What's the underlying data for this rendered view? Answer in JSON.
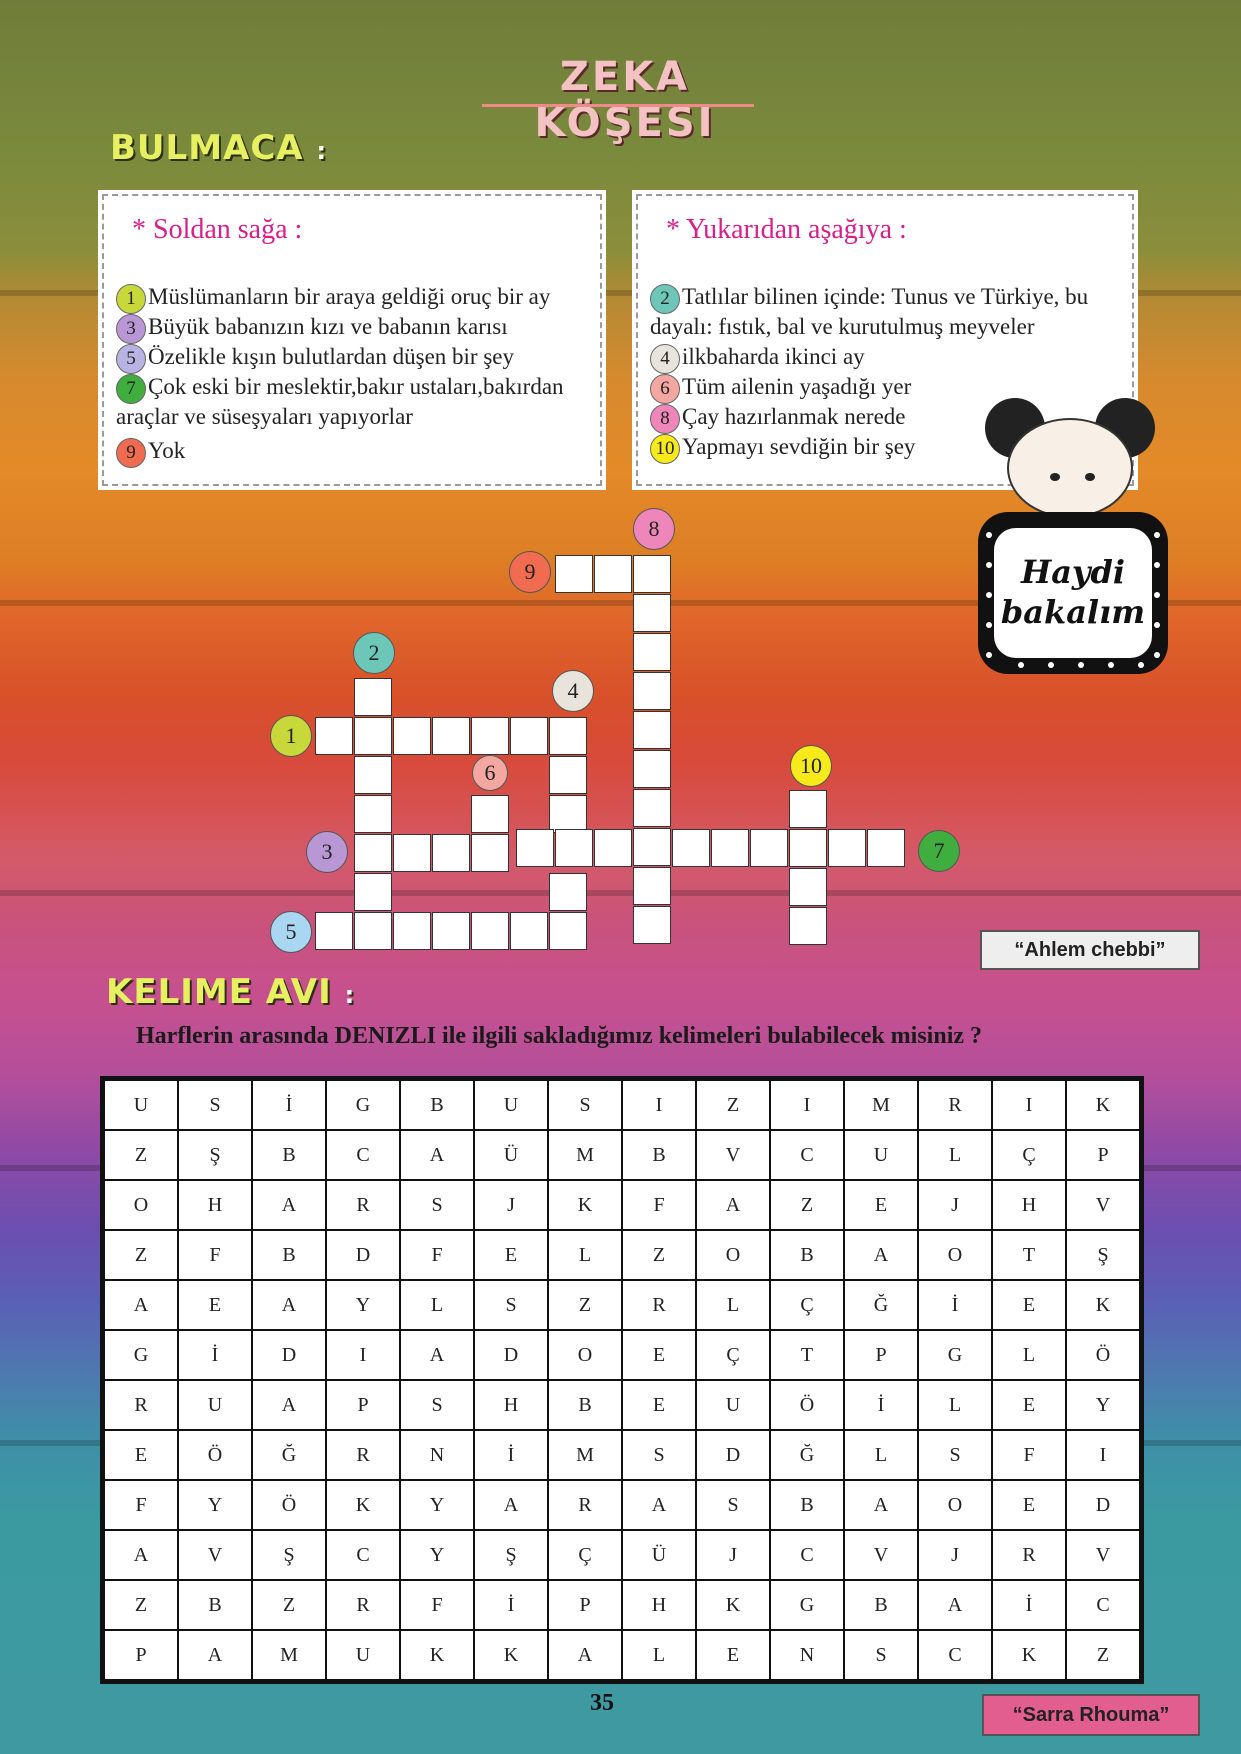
{
  "title": "ZEKA KÖŞESI",
  "bulmaca": {
    "heading": "BULMACA",
    "colon": ":",
    "across": {
      "heading": "* Soldan sağa :",
      "clues": [
        {
          "num": "1",
          "color": "#c8d83a",
          "text": "Müslümanların bir araya geldiği oruç bir ay"
        },
        {
          "num": "3",
          "color": "#b897d4",
          "text": "Büyük babanızın kızı ve babanın karısı"
        },
        {
          "num": "5",
          "color": "#b9b3e3",
          "text": "Özelikle kışın bulutlardan düşen bir şey"
        },
        {
          "num": "7",
          "color": "#3fae3f",
          "text": "Çok eski bir meslektir,bakır ustaları,bakırdan",
          "text2": "araçlar ve süseşyaları yapıyorlar"
        },
        {
          "num": "9",
          "color": "#f06b4f",
          "text": "Yok"
        }
      ]
    },
    "down": {
      "heading": "* Yukarıdan aşağıya :",
      "clues": [
        {
          "num": "2",
          "color": "#6cc7b9",
          "text": "Tatlılar bilinen içinde: Tunus ve Türkiye, bu",
          "text2": "dayalı: fıstık, bal ve kurutulmuş meyveler"
        },
        {
          "num": "4",
          "color": "#e8e4dc",
          "text": "ilkbaharda ikinci ay"
        },
        {
          "num": "6",
          "color": "#f4a7a1",
          "text": "Tüm ailenin yaşadığı yer"
        },
        {
          "num": "8",
          "color": "#ee86b9",
          "text": "Çay hazırlanmak nerede"
        },
        {
          "num": "10",
          "color": "#f6ea1a",
          "text": "Yapmayı sevdiğin bir şey"
        }
      ]
    },
    "numbers": [
      "1",
      "2",
      "3",
      "4",
      "5",
      "6",
      "7",
      "8",
      "9",
      "10"
    ]
  },
  "haydi": "Haydi bakalım",
  "credit1": "“Ahlem chebbi”",
  "kelime_avi": {
    "heading": "KELIME AVI",
    "colon": ":",
    "question": "Harflerin arasında DENIZLI ile ilgili sakladığımız kelimeleri bulabilecek misiniz ?",
    "rows": [
      [
        "U",
        "S",
        "İ",
        "G",
        "B",
        "U",
        "S",
        "I",
        "Z",
        "I",
        "M",
        "R",
        "I",
        "K"
      ],
      [
        "Z",
        "Ş",
        "B",
        "C",
        "A",
        "Ü",
        "M",
        "B",
        "V",
        "C",
        "U",
        "L",
        "Ç",
        "P"
      ],
      [
        "O",
        "H",
        "A",
        "R",
        "S",
        "J",
        "K",
        "F",
        "A",
        "Z",
        "E",
        "J",
        "H",
        "V"
      ],
      [
        "Z",
        "F",
        "B",
        "D",
        "F",
        "E",
        "L",
        "Z",
        "O",
        "B",
        "A",
        "O",
        "T",
        "Ş"
      ],
      [
        "A",
        "E",
        "A",
        "Y",
        "L",
        "S",
        "Z",
        "R",
        "L",
        "Ç",
        "Ğ",
        "İ",
        "E",
        "K"
      ],
      [
        "G",
        "İ",
        "D",
        "I",
        "A",
        "D",
        "O",
        "E",
        "Ç",
        "T",
        "P",
        "G",
        "L",
        "Ö"
      ],
      [
        "R",
        "U",
        "A",
        "P",
        "S",
        "H",
        "B",
        "E",
        "U",
        "Ö",
        "İ",
        "L",
        "E",
        "Y"
      ],
      [
        "E",
        "Ö",
        "Ğ",
        "R",
        "N",
        "İ",
        "M",
        "S",
        "D",
        "Ğ",
        "L",
        "S",
        "F",
        "I"
      ],
      [
        "F",
        "Y",
        "Ö",
        "K",
        "Y",
        "A",
        "R",
        "A",
        "S",
        "B",
        "A",
        "O",
        "E",
        "D"
      ],
      [
        "A",
        "V",
        "Ş",
        "C",
        "Y",
        "Ş",
        "Ç",
        "Ü",
        "J",
        "C",
        "V",
        "J",
        "R",
        "V"
      ],
      [
        "Z",
        "B",
        "Z",
        "R",
        "F",
        "İ",
        "P",
        "H",
        "K",
        "G",
        "B",
        "A",
        "İ",
        "C"
      ],
      [
        "P",
        "A",
        "M",
        "U",
        "K",
        "K",
        "A",
        "L",
        "E",
        "N",
        "S",
        "C",
        "K",
        "Z"
      ]
    ]
  },
  "page_number": "35",
  "credit2": "“Sarra Rhouma”"
}
